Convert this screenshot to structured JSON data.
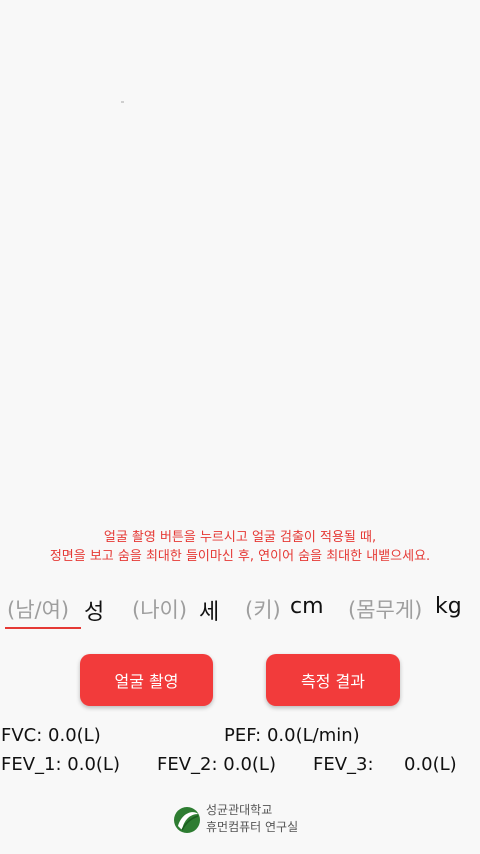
{
  "instruction": {
    "line1": "얼굴 촬영 버튼을 누르시고 얼굴 검출이 적용될 때,",
    "line2": "정면을 보고 숨을 최대한 들이마신 후, 연이어 숨을 최대한 내뱉으세요."
  },
  "inputs": {
    "gender": {
      "placeholder": "(남/여)",
      "unit": "성"
    },
    "age": {
      "placeholder": "(나이)",
      "unit": "세"
    },
    "height": {
      "placeholder": "(키)",
      "unit": "cm"
    },
    "weight": {
      "placeholder": "(몸무게)",
      "unit": "kg"
    }
  },
  "buttons": {
    "face_capture": "얼굴 촬영",
    "measure_result": "측정 결과"
  },
  "metrics": {
    "fvc": "FVC:  0.0(L)",
    "pef": "PEF:  0.0(L/min)",
    "fev1": "FEV_1: 0.0(L)",
    "fev2": "FEV_2: 0.0(L)",
    "fev3_label": "FEV_3:",
    "fev3_value": "0.0(L)"
  },
  "logo": {
    "line1": "성균관대학교",
    "line2": "휴먼컴퓨터 연구실"
  },
  "colors": {
    "accent": "#f23b3b",
    "instruction": "#e53935",
    "background": "#f8f8f8"
  }
}
